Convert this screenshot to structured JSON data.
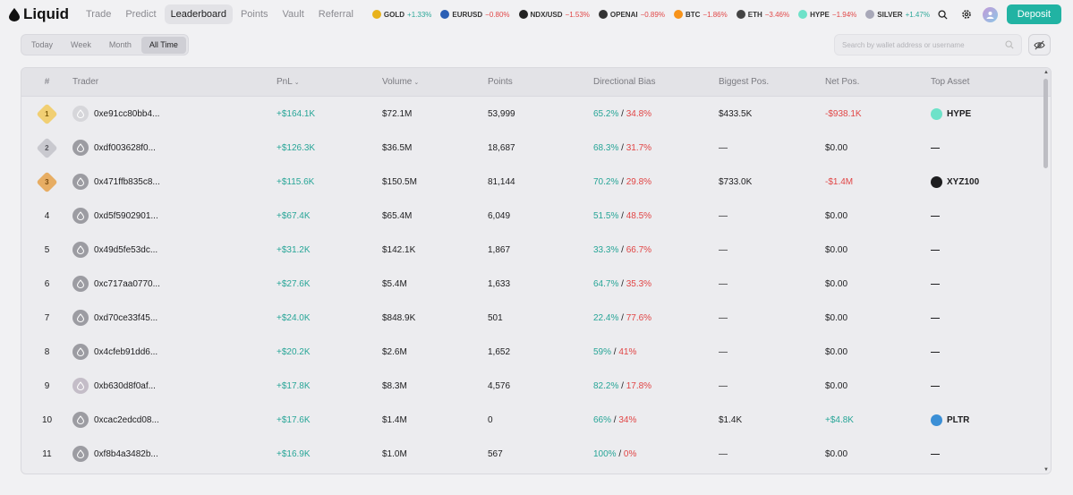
{
  "brand": {
    "name": "Liquid"
  },
  "nav": [
    "Trade",
    "Predict",
    "Leaderboard",
    "Points",
    "Vault",
    "Referral"
  ],
  "nav_active": "Leaderboard",
  "tickers": [
    {
      "sym": "GOLD",
      "chg": "+1.33%",
      "dir": "pos",
      "icon_color": "#e8b21b",
      "icon": "gold-coin-icon"
    },
    {
      "sym": "EURUSD",
      "chg": "−0.80%",
      "dir": "neg",
      "icon_color": "#2b5fb5",
      "icon": "euro-flag-icon"
    },
    {
      "sym": "NDX/USD",
      "chg": "−1.53%",
      "dir": "neg",
      "icon_color": "#222222",
      "icon": "ndx-icon"
    },
    {
      "sym": "OPENAI",
      "chg": "−0.89%",
      "dir": "neg",
      "icon_color": "#333333",
      "icon": "openai-icon"
    },
    {
      "sym": "BTC",
      "chg": "−1.86%",
      "dir": "neg",
      "icon_color": "#f7931a",
      "icon": "bitcoin-icon"
    },
    {
      "sym": "ETH",
      "chg": "−3.46%",
      "dir": "neg",
      "icon_color": "#444444",
      "icon": "ethereum-icon"
    },
    {
      "sym": "HYPE",
      "chg": "−1.94%",
      "dir": "neg",
      "icon_color": "#6ee2c9",
      "icon": "hype-icon"
    },
    {
      "sym": "SILVER",
      "chg": "+1.47%",
      "dir": "pos",
      "icon_color": "#a8a8b8",
      "icon": "silver-coin-icon"
    }
  ],
  "deposit_label": "Deposit",
  "periods": [
    "Today",
    "Week",
    "Month",
    "All Time"
  ],
  "period_active": "All Time",
  "search": {
    "placeholder": "Search by wallet address or username",
    "value": ""
  },
  "columns": {
    "rank": "#",
    "trader": "Trader",
    "pnl": "PnL",
    "volume": "Volume",
    "points": "Points",
    "bias": "Directional Bias",
    "biggest": "Biggest Pos.",
    "net": "Net Pos.",
    "asset": "Top Asset"
  },
  "rows": [
    {
      "rank": "1",
      "medal": "gold",
      "avatar": "img1",
      "trader": "0xe91cc80bb4...",
      "pnl": "+$164.1K",
      "volume": "$72.1M",
      "points": "53,999",
      "long": "65.2%",
      "short": "34.8%",
      "biggest": "$433.5K",
      "net": "-$938.1K",
      "net_dir": "neg",
      "asset": "HYPE",
      "asset_icon": "hype-icon",
      "asset_color": "#6ee2c9"
    },
    {
      "rank": "2",
      "medal": "silver",
      "avatar": "",
      "trader": "0xdf003628f0...",
      "pnl": "+$126.3K",
      "volume": "$36.5M",
      "points": "18,687",
      "long": "68.3%",
      "short": "31.7%",
      "biggest": "—",
      "net": "$0.00",
      "net_dir": "",
      "asset": "—",
      "asset_icon": "",
      "asset_color": ""
    },
    {
      "rank": "3",
      "medal": "bronze",
      "avatar": "",
      "trader": "0x471ffb835c8...",
      "pnl": "+$115.6K",
      "volume": "$150.5M",
      "points": "81,144",
      "long": "70.2%",
      "short": "29.8%",
      "biggest": "$733.0K",
      "net": "-$1.4M",
      "net_dir": "neg",
      "asset": "XYZ100",
      "asset_icon": "xyz100-icon",
      "asset_color": "#1d1d1f"
    },
    {
      "rank": "4",
      "medal": "",
      "avatar": "",
      "trader": "0xd5f5902901...",
      "pnl": "+$67.4K",
      "volume": "$65.4M",
      "points": "6,049",
      "long": "51.5%",
      "short": "48.5%",
      "biggest": "—",
      "net": "$0.00",
      "net_dir": "",
      "asset": "—",
      "asset_icon": "",
      "asset_color": ""
    },
    {
      "rank": "5",
      "medal": "",
      "avatar": "",
      "trader": "0x49d5fe53dc...",
      "pnl": "+$31.2K",
      "volume": "$142.1K",
      "points": "1,867",
      "long": "33.3%",
      "short": "66.7%",
      "biggest": "—",
      "net": "$0.00",
      "net_dir": "",
      "asset": "—",
      "asset_icon": "",
      "asset_color": ""
    },
    {
      "rank": "6",
      "medal": "",
      "avatar": "",
      "trader": "0xc717aa0770...",
      "pnl": "+$27.6K",
      "volume": "$5.4M",
      "points": "1,633",
      "long": "64.7%",
      "short": "35.3%",
      "biggest": "—",
      "net": "$0.00",
      "net_dir": "",
      "asset": "—",
      "asset_icon": "",
      "asset_color": ""
    },
    {
      "rank": "7",
      "medal": "",
      "avatar": "",
      "trader": "0xd70ce33f45...",
      "pnl": "+$24.0K",
      "volume": "$848.9K",
      "points": "501",
      "long": "22.4%",
      "short": "77.6%",
      "biggest": "—",
      "net": "$0.00",
      "net_dir": "",
      "asset": "—",
      "asset_icon": "",
      "asset_color": ""
    },
    {
      "rank": "8",
      "medal": "",
      "avatar": "",
      "trader": "0x4cfeb91dd6...",
      "pnl": "+$20.2K",
      "volume": "$2.6M",
      "points": "1,652",
      "long": "59%",
      "short": "41%",
      "biggest": "—",
      "net": "$0.00",
      "net_dir": "",
      "asset": "—",
      "asset_icon": "",
      "asset_color": ""
    },
    {
      "rank": "9",
      "medal": "",
      "avatar": "img2",
      "trader": "0xb630d8f0af...",
      "pnl": "+$17.8K",
      "volume": "$8.3M",
      "points": "4,576",
      "long": "82.2%",
      "short": "17.8%",
      "biggest": "—",
      "net": "$0.00",
      "net_dir": "",
      "asset": "—",
      "asset_icon": "",
      "asset_color": ""
    },
    {
      "rank": "10",
      "medal": "",
      "avatar": "",
      "trader": "0xcac2edcd08...",
      "pnl": "+$17.6K",
      "volume": "$1.4M",
      "points": "0",
      "long": "66%",
      "short": "34%",
      "biggest": "$1.4K",
      "net": "+$4.8K",
      "net_dir": "pos",
      "asset": "PLTR",
      "asset_icon": "pltr-icon",
      "asset_color": "#3b8fd6"
    },
    {
      "rank": "11",
      "medal": "",
      "avatar": "",
      "trader": "0xf8b4a3482b...",
      "pnl": "+$16.9K",
      "volume": "$1.0M",
      "points": "567",
      "long": "100%",
      "short": "0%",
      "biggest": "—",
      "net": "$0.00",
      "net_dir": "",
      "asset": "—",
      "asset_icon": "",
      "asset_color": ""
    }
  ]
}
